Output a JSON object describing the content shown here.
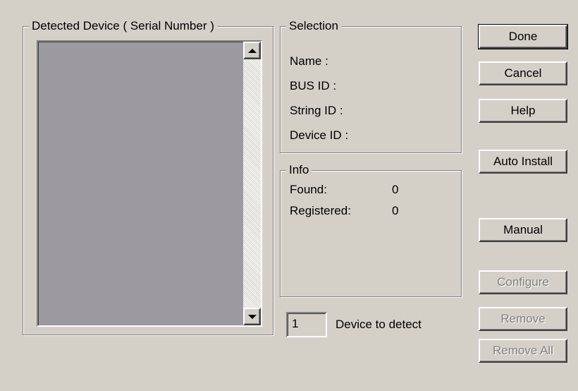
{
  "detected_group": {
    "label": "Detected Device ( Serial Number )"
  },
  "selection": {
    "label": "Selection",
    "fields": [
      "Name :",
      "BUS ID :",
      "String ID :",
      "Device ID :"
    ]
  },
  "info": {
    "label": "Info",
    "found_label": "Found:",
    "found_value": "0",
    "registered_label": "Registered:",
    "registered_value": "0"
  },
  "detect": {
    "count": "1",
    "label": "Device to detect"
  },
  "buttons": {
    "done": "Done",
    "cancel": "Cancel",
    "help": "Help",
    "auto_install": "Auto Install",
    "manual": "Manual",
    "configure": "Configure",
    "remove": "Remove",
    "remove_all": "Remove All"
  }
}
